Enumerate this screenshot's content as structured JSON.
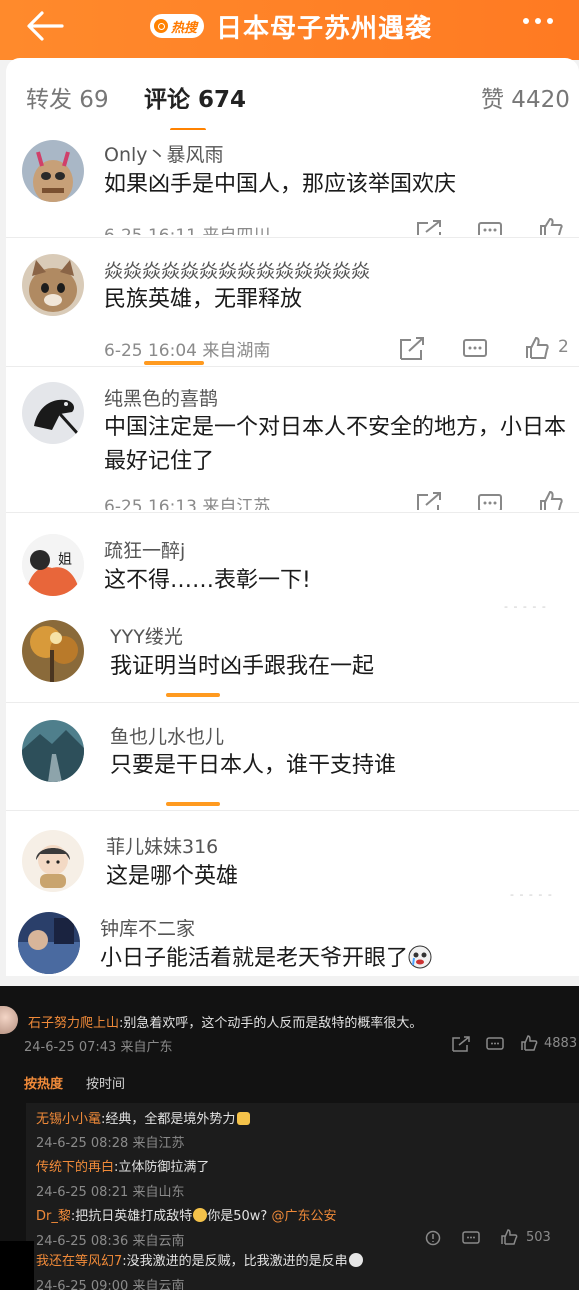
{
  "header": {
    "hot_badge": "热搜",
    "title": "日本母子苏州遇袭",
    "icons": [
      "back-arrow-icon",
      "more-dots-icon"
    ]
  },
  "tabs": {
    "repost": "转发 69",
    "comments": "评论 674",
    "likes": "赞 4420"
  },
  "comments": [
    {
      "user": "Only丶暴风雨",
      "text": "如果凶手是中国人，那应该举国欢庆",
      "meta": "6-25 16:11  来自四川",
      "likes": ""
    },
    {
      "user": "焱焱焱焱焱焱焱焱焱焱焱焱焱焱",
      "text": "民族英雄，无罪释放",
      "meta": "6-25 16:04  来自湖南",
      "likes": "2"
    },
    {
      "user": "纯黑色的喜鹊",
      "text": "中国注定是一个对日本人不安全的地方，小日本最好记住了",
      "meta": "6-25 16:13  来自江苏",
      "likes": ""
    },
    {
      "user": "疏狂一醉j",
      "text": "这不得……表彰一下!",
      "avatar_text": "姐"
    },
    {
      "user": "YYY缕光",
      "text": "我证明当时凶手跟我在一起"
    },
    {
      "user": "鱼也儿水也儿",
      "text": "只要是干日本人，谁干支持谁"
    },
    {
      "user": "菲儿妹妹316",
      "text": "这是哪个英雄"
    },
    {
      "user": "钟库不二家",
      "text": "小日子能活着就是老天爷开眼了"
    }
  ],
  "dark_section": {
    "top_comment": {
      "user": "石子努力爬上山",
      "text": ":别急着欢呼，这个动手的人反而是敌特的概率很大。",
      "meta": "24-6-25 07:43 来自广东",
      "likes": "4883"
    },
    "sort_tabs": {
      "hot": "按热度",
      "time": "按时间"
    },
    "replies": [
      {
        "user": "无锡小小鼋",
        "text": ":经典，全都是境外势力",
        "meta": "24-6-25 08:28 来自江苏"
      },
      {
        "user": "传统下的再白",
        "text": ":立体防御拉满了",
        "meta": "24-6-25 08:21 来自山东"
      },
      {
        "user": "Dr_黎",
        "text": ":把抗日英雄打成敌特",
        "text2": "你是50w?",
        "mention": "@广东公安",
        "meta": "24-6-25 08:36 来自云南",
        "likes": "503"
      },
      {
        "user": "我还在等风幻7",
        "text": ":没我激进的是反贼，比我激进的是反串",
        "meta": "24-6-25 09:00 来自云南"
      }
    ]
  },
  "colors": {
    "brand_orange": "#ff8200",
    "dark_bg": "#121212",
    "username_orange": "#f08a39"
  }
}
